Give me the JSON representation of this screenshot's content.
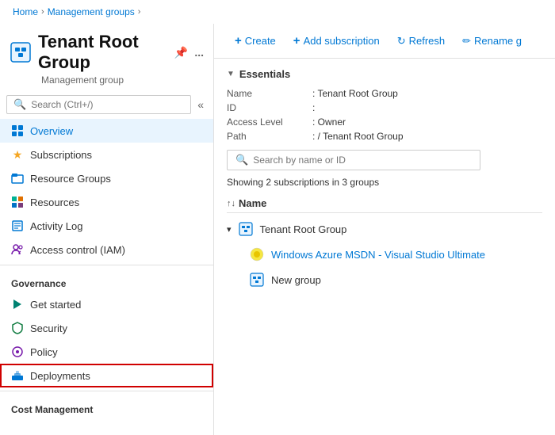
{
  "breadcrumb": {
    "items": [
      "Home",
      "Management groups"
    ],
    "current": ""
  },
  "header": {
    "title": "Tenant Root Group",
    "subtitle": "Management group",
    "pin_icon": "📌",
    "more_icon": "..."
  },
  "sidebar_search": {
    "placeholder": "Search (Ctrl+/)"
  },
  "nav": {
    "items": [
      {
        "id": "overview",
        "label": "Overview",
        "icon": "grid",
        "active": true
      },
      {
        "id": "subscriptions",
        "label": "Subscriptions",
        "icon": "star"
      },
      {
        "id": "resource-groups",
        "label": "Resource Groups",
        "icon": "layers"
      },
      {
        "id": "resources",
        "label": "Resources",
        "icon": "grid4"
      },
      {
        "id": "activity-log",
        "label": "Activity Log",
        "icon": "list"
      },
      {
        "id": "access-control",
        "label": "Access control (IAM)",
        "icon": "people"
      }
    ],
    "sections": [
      {
        "label": "Governance",
        "items": [
          {
            "id": "get-started",
            "label": "Get started",
            "icon": "flag"
          },
          {
            "id": "security",
            "label": "Security",
            "icon": "shield"
          },
          {
            "id": "policy",
            "label": "Policy",
            "icon": "cog"
          },
          {
            "id": "deployments",
            "label": "Deployments",
            "icon": "deploy",
            "highlighted": true
          }
        ]
      },
      {
        "label": "Cost Management",
        "items": []
      }
    ]
  },
  "toolbar": {
    "create_label": "Create",
    "add_subscription_label": "Add subscription",
    "refresh_label": "Refresh",
    "rename_label": "Rename g"
  },
  "essentials": {
    "header": "Essentials",
    "name_label": "Name",
    "name_value": "Tenant Root Group",
    "id_label": "ID",
    "id_value": "",
    "access_level_label": "Access Level",
    "access_level_value": "Owner",
    "path_label": "Path",
    "path_value": "/ Tenant Root Group"
  },
  "filter": {
    "placeholder": "Search by name or ID"
  },
  "showing_text": "Showing 2 subscriptions in 3 groups",
  "list": {
    "column_name": "Name",
    "items": [
      {
        "type": "group",
        "label": "Tenant Root Group",
        "expanded": true,
        "children": [
          {
            "type": "subscription",
            "label": "Windows Azure MSDN - Visual Studio Ultimate",
            "link": true
          },
          {
            "type": "group",
            "label": "New group",
            "link": false
          }
        ]
      }
    ]
  }
}
